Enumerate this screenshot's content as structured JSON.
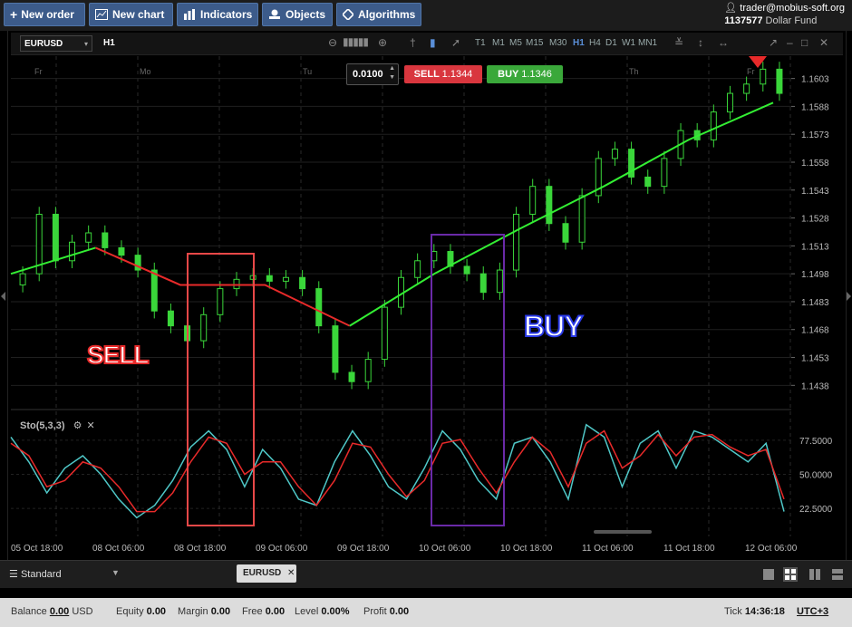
{
  "toolbar": {
    "new_order": "New order",
    "new_chart": "New chart",
    "indicators": "Indicators",
    "objects": "Objects",
    "algorithms": "Algorithms"
  },
  "account": {
    "user": "trader@mobius-soft.org",
    "number": "1137577",
    "fund": "Dollar Fund"
  },
  "chart_window": {
    "symbol": "EURUSD",
    "timeframe": "H1",
    "timeframes": [
      "T1",
      "M1",
      "M5",
      "M15",
      "M30",
      "H1",
      "H4",
      "D1",
      "W1",
      "MN1"
    ],
    "active_timeframe": "H1"
  },
  "trade": {
    "lot": "0.0100",
    "sell_label": "SELL",
    "sell_price": "1.1344",
    "buy_label": "BUY",
    "buy_price": "1.1346"
  },
  "chart_data": {
    "type": "candlestick",
    "symbol": "EURUSD",
    "interval": "H1",
    "price_axis_ticks": [
      "1.1603",
      "1.1588",
      "1.1573",
      "1.1558",
      "1.1543",
      "1.1528",
      "1.1513",
      "1.1498",
      "1.1483",
      "1.1468",
      "1.1453",
      "1.1438"
    ],
    "day_labels": [
      "Fr",
      "Mo",
      "Tu",
      "Th",
      "Fr"
    ],
    "time_axis_ticks": [
      "05 Oct 18:00",
      "08 Oct 06:00",
      "08 Oct 18:00",
      "09 Oct 06:00",
      "09 Oct 18:00",
      "10 Oct 06:00",
      "10 Oct 18:00",
      "11 Oct 06:00",
      "11 Oct 18:00",
      "12 Oct 06:00"
    ],
    "candle_approx_closes": [
      1.1498,
      1.153,
      1.1505,
      1.1515,
      1.152,
      1.1512,
      1.1508,
      1.15,
      1.1478,
      1.147,
      1.1462,
      1.1476,
      1.149,
      1.1495,
      1.1497,
      1.1494,
      1.1496,
      1.149,
      1.147,
      1.1445,
      1.144,
      1.1452,
      1.148,
      1.1496,
      1.1505,
      1.151,
      1.1502,
      1.1498,
      1.1488,
      1.15,
      1.153,
      1.1545,
      1.1525,
      1.1515,
      1.154,
      1.156,
      1.1565,
      1.155,
      1.1545,
      1.156,
      1.1575,
      1.157,
      1.1585,
      1.1595,
      1.16,
      1.1608,
      1.1595
    ],
    "trailing_stop_line": {
      "colors": {
        "buy": "#33ee33",
        "sell": "#e82a2a"
      },
      "segments": [
        {
          "side": "buy",
          "values": [
            1.1498,
            1.1512
          ]
        },
        {
          "side": "sell",
          "values": [
            1.1512,
            1.1492,
            1.1492,
            1.147
          ]
        },
        {
          "side": "buy",
          "values": [
            1.147,
            1.1498,
            1.1522,
            1.1545,
            1.157,
            1.159
          ]
        }
      ]
    },
    "oscillator": {
      "name": "Sto(5,3,3)",
      "levels": [
        "77.5000",
        "50.0000",
        "22.5000"
      ],
      "series": [
        {
          "color": "#4fc7c7",
          "values": [
            80,
            60,
            35,
            55,
            65,
            50,
            30,
            15,
            25,
            45,
            72,
            85,
            70,
            40,
            70,
            55,
            30,
            25,
            60,
            85,
            65,
            40,
            30,
            55,
            85,
            70,
            45,
            30,
            75,
            80,
            60,
            30,
            90,
            80,
            40,
            75,
            85,
            55,
            85,
            80,
            70,
            60,
            75,
            20
          ]
        },
        {
          "color": "#e82a2a",
          "values": [
            75,
            65,
            40,
            45,
            60,
            55,
            40,
            20,
            20,
            35,
            60,
            80,
            75,
            50,
            60,
            60,
            40,
            25,
            45,
            75,
            72,
            50,
            32,
            45,
            75,
            78,
            55,
            35,
            60,
            80,
            68,
            40,
            75,
            85,
            55,
            65,
            82,
            65,
            80,
            82,
            72,
            65,
            70,
            30
          ]
        }
      ]
    }
  },
  "annotations": {
    "sell_text": "SELL",
    "buy_text": "BUY"
  },
  "bottom_tabs": {
    "workspace": "Standard",
    "tab": "EURUSD"
  },
  "status": {
    "balance_label": "Balance",
    "balance_value": "0.00",
    "balance_currency": "USD",
    "equity_label": "Equity",
    "equity_value": "0.00",
    "margin_label": "Margin",
    "margin_value": "0.00",
    "free_label": "Free",
    "free_value": "0.00",
    "level_label": "Level",
    "level_value": "0.00%",
    "profit_label": "Profit",
    "profit_value": "0.00",
    "tick_label": "Tick",
    "tick_time": "14:36:18",
    "timezone": "UTC+3"
  }
}
